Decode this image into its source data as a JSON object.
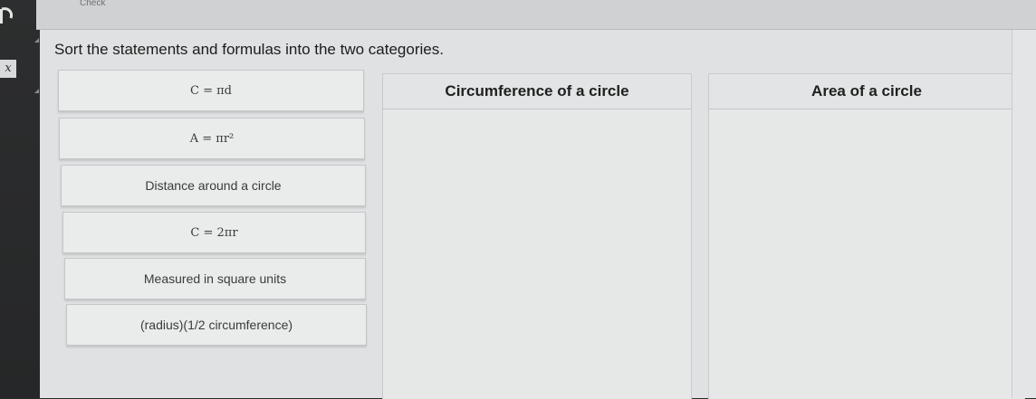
{
  "toolbar": {
    "check_label": "Check"
  },
  "sidebar": {
    "fx_icon": "x"
  },
  "question": {
    "instructions": "Sort the statements and formulas into the two categories."
  },
  "cards": [
    {
      "text": "C = πd",
      "kind": "formula"
    },
    {
      "text": "A = πr²",
      "kind": "formula"
    },
    {
      "text": "Distance around a circle",
      "kind": "statement"
    },
    {
      "text": "C = 2πr",
      "kind": "formula"
    },
    {
      "text": "Measured in square units",
      "kind": "statement"
    },
    {
      "text": "(radius)(1/2 circumference)",
      "kind": "statement"
    }
  ],
  "categories": [
    {
      "title": "Circumference of a circle"
    },
    {
      "title": "Area of a circle"
    }
  ],
  "icons": [
    "back-arrow-icon",
    "function-icon",
    "collapse-triangle-icon"
  ],
  "colors": {
    "background": "#dfe1e2",
    "card": "#eaebeb",
    "sidebar": "#2a2b2c"
  }
}
